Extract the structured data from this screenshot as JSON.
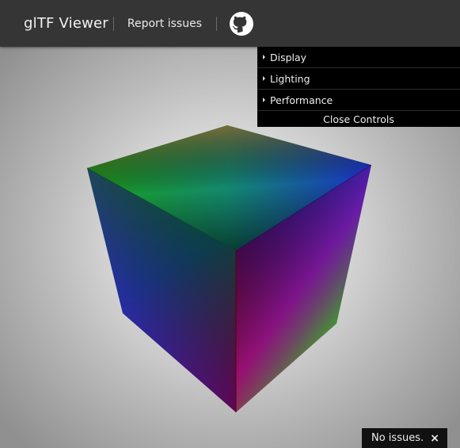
{
  "header": {
    "brand": "glTF Viewer",
    "report_link": "Report issues",
    "github_icon": "github-icon"
  },
  "controls": {
    "items": [
      {
        "label": "Display"
      },
      {
        "label": "Lighting"
      },
      {
        "label": "Performance"
      }
    ],
    "close_label": "Close Controls"
  },
  "status": {
    "text": "No issues.",
    "close_glyph": "×"
  },
  "colors": {
    "header_bg": "#353535",
    "controls_bg": "#000000",
    "cube_red": "#c00000",
    "cube_green": "#00b000",
    "cube_blue": "#0000c0"
  }
}
